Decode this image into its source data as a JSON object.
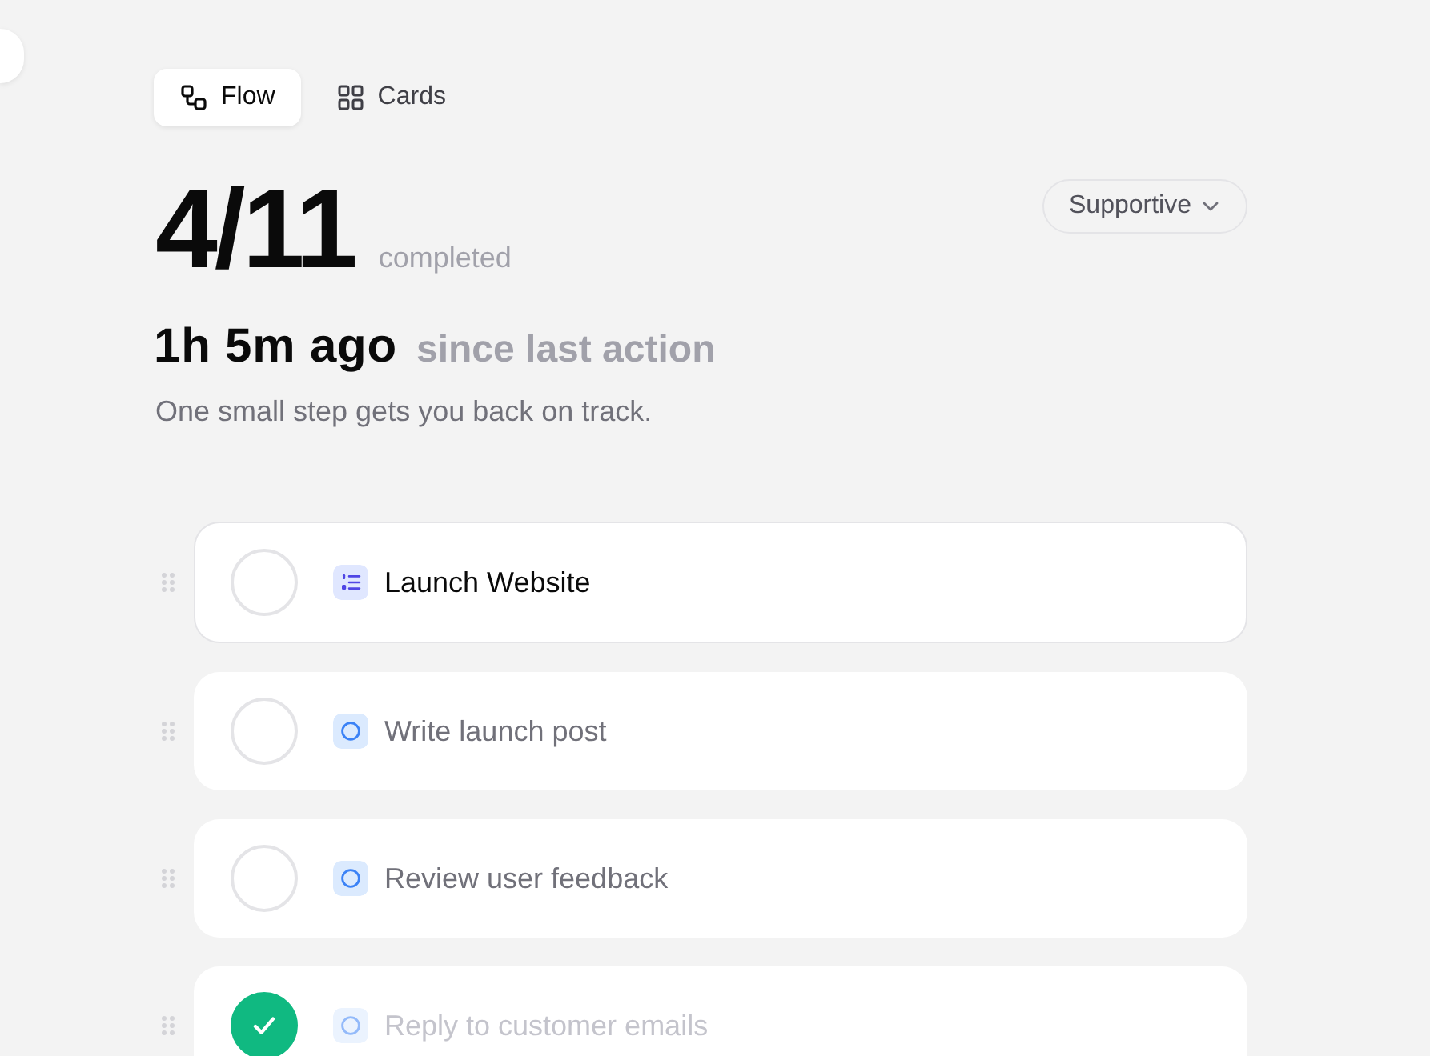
{
  "view_tabs": [
    {
      "label": "Flow",
      "kind": "flow",
      "selected": true
    },
    {
      "label": "Cards",
      "kind": "cards",
      "selected": false
    }
  ],
  "progress": {
    "count": "4/11",
    "label": "completed"
  },
  "tone_dropdown": {
    "value": "Supportive"
  },
  "last_action": {
    "elapsed": "1h 5m ago",
    "label": "since last action",
    "message": "One small step gets you back on track."
  },
  "tasks": [
    {
      "title": "Launch Website",
      "kind": "project",
      "selected": true,
      "checked": false
    },
    {
      "title": "Write launch post",
      "kind": "task",
      "selected": false,
      "checked": false
    },
    {
      "title": "Review user feedback",
      "kind": "task",
      "selected": false,
      "checked": false
    },
    {
      "title": "Reply to customer emails",
      "kind": "task",
      "selected": false,
      "checked": true
    }
  ]
}
